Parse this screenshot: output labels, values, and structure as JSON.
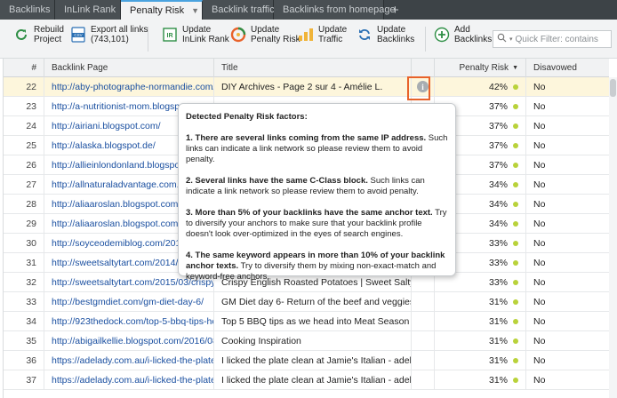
{
  "tabs": [
    {
      "label": "Backlinks",
      "active": false
    },
    {
      "label": "InLink Rank",
      "active": false
    },
    {
      "label": "Penalty Risk",
      "active": true
    },
    {
      "label": "Backlink traffic",
      "active": false
    },
    {
      "label": "Backlinks from homepage",
      "active": false
    }
  ],
  "tab_add": "+",
  "toolbar": {
    "rebuild": "Rebuild\nProject",
    "export": "Export all links\n(743,101)",
    "update_inlink": "Update\nInLink Rank",
    "update_penalty": "Update\nPenalty Risk",
    "update_traffic": "Update\nTraffic",
    "update_backlinks": "Update\nBacklinks",
    "add_backlinks": "Add\nBacklinks",
    "search_placeholder": "Quick Filter: contains"
  },
  "columns": {
    "num": "#",
    "page": "Backlink Page",
    "title": "Title",
    "risk": "Penalty Risk",
    "disavowed": "Disavowed"
  },
  "rows": [
    {
      "num": "22",
      "page": "http://aby-photographe-normandie.com/d...",
      "title": "DIY Archives - Page 2 sur 4 - Amélie L.",
      "risk": "42%",
      "disavowed": "No"
    },
    {
      "num": "23",
      "page": "http://a-nutritionist-mom.blogspot.com",
      "title": "",
      "risk": "37%",
      "disavowed": "No"
    },
    {
      "num": "24",
      "page": "http://airiani.blogspot.com/",
      "title": "",
      "risk": "37%",
      "disavowed": "No"
    },
    {
      "num": "25",
      "page": "http://alaska.blogspot.de/",
      "title": "",
      "risk": "37%",
      "disavowed": "No"
    },
    {
      "num": "26",
      "page": "http://allieinlondonland.blogspot.com",
      "title": "",
      "risk": "37%",
      "disavowed": "No"
    },
    {
      "num": "27",
      "page": "http://allnaturaladvantage.com.au/ho",
      "title": "",
      "risk": "34%",
      "disavowed": "No"
    },
    {
      "num": "28",
      "page": "http://aliaaroslan.blogspot.com/2016",
      "title": "",
      "risk": "34%",
      "disavowed": "No"
    },
    {
      "num": "29",
      "page": "http://aliaaroslan.blogspot.com/2016",
      "title": "",
      "risk": "34%",
      "disavowed": "No"
    },
    {
      "num": "30",
      "page": "http://soyceodemiblog.com/2010/12",
      "title": "",
      "risk": "33%",
      "disavowed": "No"
    },
    {
      "num": "31",
      "page": "http://sweetsaltytart.com/2014/05/a-",
      "title": "",
      "risk": "33%",
      "disavowed": "No"
    },
    {
      "num": "32",
      "page": "http://sweetsaltytart.com/2015/03/crispy-...",
      "title": "Crispy English Roasted Potatoes | Sweet Salty Tart",
      "risk": "33%",
      "disavowed": "No"
    },
    {
      "num": "33",
      "page": "http://bestgmdiet.com/gm-diet-day-6/",
      "title": "GM Diet day 6- Return of the beef and veggies",
      "risk": "31%",
      "disavowed": "No"
    },
    {
      "num": "34",
      "page": "http://923thedock.com/top-5-bbq-tips-he...",
      "title": "Top 5 BBQ tips as we head into Meat Season",
      "risk": "31%",
      "disavowed": "No"
    },
    {
      "num": "35",
      "page": "http://abigailkellie.blogspot.com/2016/08/...",
      "title": "Cooking Inspiration",
      "risk": "31%",
      "disavowed": "No"
    },
    {
      "num": "36",
      "page": "https://adelady.com.au/i-licked-the-plate-...",
      "title": "I licked the plate clean at Jamie's Italian - adelady",
      "risk": "31%",
      "disavowed": "No"
    },
    {
      "num": "37",
      "page": "https://adelady.com.au/i-licked-the-plate-...",
      "title": "I licked the plate clean at Jamie's Italian - adelady",
      "risk": "31%",
      "disavowed": "No"
    }
  ],
  "tooltip": {
    "title": "Detected Penalty Risk factors:",
    "factors": [
      {
        "bold": "1. There are several links coming from the same IP address.",
        "text": " Such links can indicate a link network so please review them to avoid penalty."
      },
      {
        "bold": "2. Several links have the same C-Class block.",
        "text": " Such links can indicate a link network so please review them to avoid penalty."
      },
      {
        "bold": "3. More than 5% of your backlinks have the same anchor text.",
        "text": " Try to diversify your anchors to make sure that your backlink profile doesn't look over-optimized in the eyes of search engines."
      },
      {
        "bold": "4. The same keyword appears in more than 10% of your backlink anchor texts.",
        "text": " Try to diversify them by mixing non-exact-match and keyword-free anchors."
      }
    ]
  },
  "colors": {
    "accent": "#4aa3df",
    "risk_dot": "#b9d23a",
    "highlight": "#e8622a",
    "link": "#1a4fa0"
  }
}
